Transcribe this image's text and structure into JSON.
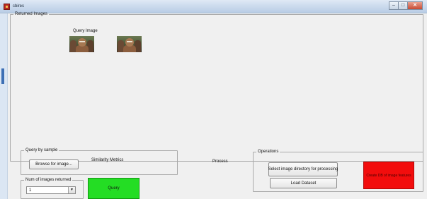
{
  "window": {
    "title": "cbires",
    "controls": {
      "minimize": "–",
      "maximize": "□",
      "close": "✕"
    },
    "icon": "matlab-figure-icon"
  },
  "returned_panel": {
    "legend": "Returned Images",
    "query_label": "Query Image",
    "thumbnails": [
      {
        "name": "query-thumbnail",
        "icon": "photo"
      },
      {
        "name": "result-thumbnail-1",
        "icon": "photo"
      }
    ]
  },
  "query_sample": {
    "legend": "Query by sample",
    "browse_label": "Browse for image...",
    "metric_label": "Similarity Metrics"
  },
  "process_label": "Process",
  "num_images": {
    "legend": "Num of images returned",
    "selected": "1"
  },
  "query_button_label": "Query",
  "operations": {
    "legend": "Operations",
    "select_dir_label": "Select image directory for processing",
    "load_dataset_label": "Load Dataset",
    "red_button_label": "Create DB of image features"
  },
  "colors": {
    "query_button": "#24dd24",
    "red_button": "#f20d0d",
    "query_label": "#e0201c",
    "titlebar": "#c9d9ec"
  }
}
